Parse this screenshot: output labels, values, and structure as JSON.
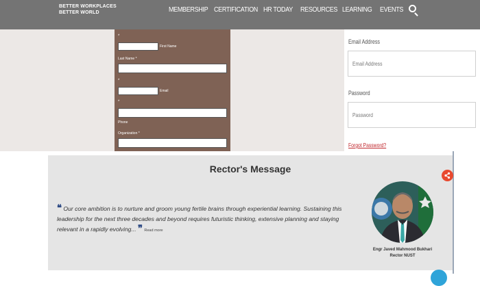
{
  "header": {
    "brand_line1": "BETTER WORKPLACES",
    "brand_line2": "BETTER WORLD",
    "nav": [
      {
        "label": "MEMBERSHIP"
      },
      {
        "label": "CERTIFICATION"
      },
      {
        "label": "HR TODAY"
      },
      {
        "label": "RESOURCES"
      },
      {
        "label": "LEARNING"
      },
      {
        "label": "EVENTS"
      }
    ],
    "search_icon": "search-icon"
  },
  "signup_form": {
    "required_mark": "*",
    "first_name_label": "First Name",
    "last_name_label": "Last Name *",
    "email_label": "Email",
    "phone_label": "Phone",
    "organization_label": "Organization *"
  },
  "login": {
    "email_label": "Email Address",
    "email_placeholder": "Email Address",
    "password_label": "Password",
    "password_placeholder": "Password",
    "forgot_link": "Forgot Password?"
  },
  "rector": {
    "title": "Rector's Message",
    "quote": "Our core ambition is to nurture and groom young fertile brains through experiential learning. Sustaining this leadership for the next three decades and beyond requires futuristic thinking, extensive planning and staying relevant in a rapidly evolving...",
    "read_more": "Read more",
    "name": "Engr Javed Mahmood Bukhari",
    "role": "Rector NUST"
  },
  "colors": {
    "nav_bg": "#747474",
    "form_bg": "#7f6255",
    "accent_red": "#c0272d",
    "share_button": "#e8492f",
    "quote_mark": "#2d4a84"
  }
}
